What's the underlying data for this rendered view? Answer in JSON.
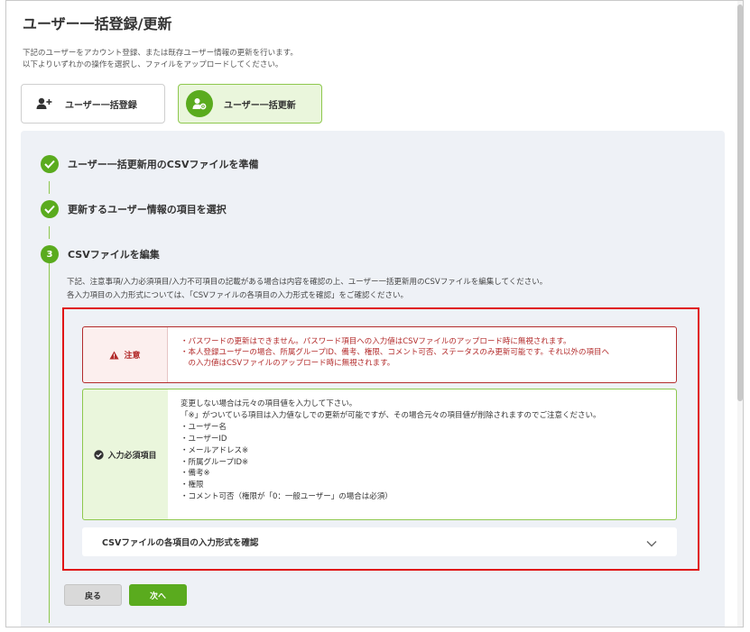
{
  "page": {
    "title": "ユーザー一括登録/更新",
    "description": [
      "下記のユーザーをアカウント登録、または既存ユーザー情報の更新を行います。",
      "以下よりいずれかの操作を選択し、ファイルをアップロードしてください。"
    ]
  },
  "modes": {
    "register_label": "ユーザー一括登録",
    "update_label": "ユーザー一括更新",
    "selected": "update"
  },
  "steps": [
    {
      "label": "ユーザー一括更新用のCSVファイルを準備",
      "status": "done"
    },
    {
      "label": "更新するユーザー情報の項目を選択",
      "status": "done"
    },
    {
      "number": "3",
      "label": "CSVファイルを編集",
      "status": "current"
    }
  ],
  "step3": {
    "description": [
      "下記、注意事項/入力必須項目/入力不可項目の記載がある場合は内容を確認の上、ユーザー一括更新用のCSVファイルを編集してください。",
      "各入力項目の入力形式については、「CSVファイルの各項目の入力形式を確認」をご確認ください。"
    ]
  },
  "caution": {
    "heading": "注意",
    "lines": [
      "・パスワードの更新はできません。パスワード項目への入力値はCSVファイルのアップロード時に無視されます。",
      "・本人登録ユーザーの場合、所属グループID、備考、権限、コメント可否、ステータスのみ更新可能です。それ以外の項目へ",
      "　の入力値はCSVファイルのアップロード時に無視されます。"
    ]
  },
  "required_items": {
    "heading": "入力必須項目",
    "lines": [
      "変更しない場合は元々の項目値を入力して下さい。",
      "「※」がついている項目は入力値なしでの更新が可能ですが、その場合元々の項目値が削除されますのでご注意ください。",
      "・ユーザー名",
      "・ユーザーID",
      "・メールアドレス※",
      "・所属グループID※",
      "・備考※",
      "・権限",
      "・コメント可否（権限が「0：一般ユーザー」の場合は必須）"
    ]
  },
  "accordion": {
    "label": "CSVファイルの各項目の入力形式を確認"
  },
  "buttons": {
    "back": "戻る",
    "next": "次へ"
  },
  "colors": {
    "accent_green": "#5aab1e",
    "caution_red": "#b32c2c",
    "highlight_red": "#e01414"
  },
  "icons": {
    "register": "user-add-icon",
    "update": "user-gear-icon",
    "done": "check-circle-icon",
    "warning": "warning-icon",
    "required": "check-circle-icon",
    "accordion": "chevron-down-icon"
  }
}
